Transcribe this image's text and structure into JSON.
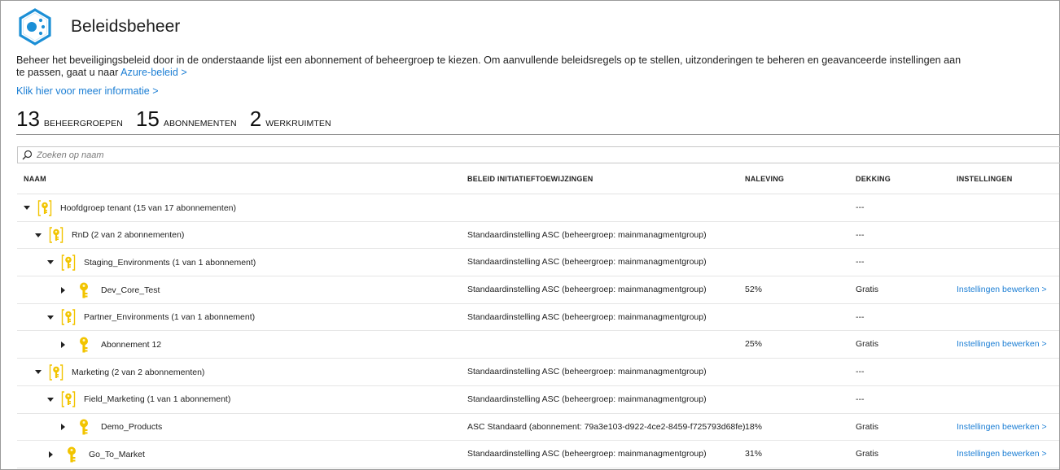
{
  "header": {
    "title": "Beleidsbeheer"
  },
  "description": {
    "text": "Beheer het beveiligingsbeleid door in de onderstaande lijst een abonnement of beheergroep te kiezen. Om aanvullende beleidsregels op te stellen, uitzonderingen te beheren en geavanceerde instellingen aan te passen, gaat u naar ",
    "link": "Azure-beleid >"
  },
  "more_info_link": "Klik hier voor meer informatie >",
  "stats": [
    {
      "value": "13",
      "label": "BEHEERGROEPEN"
    },
    {
      "value": "15",
      "label": "ABONNEMENTEN"
    },
    {
      "value": "2",
      "label": "WERKRUIMTEN"
    }
  ],
  "search": {
    "placeholder": "Zoeken op naam"
  },
  "table": {
    "headers": [
      "NAAM",
      "BELEID INITIATIEFTOEWIJZINGEN",
      "NALEVING",
      "DEKKING",
      "INSTELLINGEN"
    ],
    "rows": [
      {
        "type": "group",
        "expanded": true,
        "level": 0,
        "name": "Hoofdgroep tenant (15 van 17 abonnementen)",
        "policy": "",
        "compliance": "",
        "coverage": "---",
        "settings": ""
      },
      {
        "type": "group",
        "expanded": true,
        "level": 1,
        "name": "RnD (2 van 2 abonnementen)",
        "policy": "Standaardinstelling ASC (beheergroep: mainmanagmentgroup)",
        "compliance": "",
        "coverage": "---",
        "settings": ""
      },
      {
        "type": "group",
        "expanded": true,
        "level": 2,
        "name": "Staging_Environments (1 van 1 abonnement)",
        "policy": "Standaardinstelling ASC (beheergroep: mainmanagmentgroup)",
        "compliance": "",
        "coverage": "---",
        "settings": ""
      },
      {
        "type": "subscription",
        "expanded": false,
        "level": 3,
        "name": "Dev_Core_Test",
        "policy": "Standaardinstelling ASC (beheergroep: mainmanagmentgroup)",
        "compliance": "52%",
        "coverage": "Gratis",
        "settings": "Instellingen bewerken >"
      },
      {
        "type": "group",
        "expanded": true,
        "level": 2,
        "name": "Partner_Environments (1 van 1 abonnement)",
        "policy": "Standaardinstelling ASC (beheergroep: mainmanagmentgroup)",
        "compliance": "",
        "coverage": "---",
        "settings": ""
      },
      {
        "type": "subscription",
        "expanded": false,
        "level": 3,
        "name": "Abonnement 12",
        "policy": "",
        "compliance": "25%",
        "coverage": "Gratis",
        "settings": "Instellingen bewerken >"
      },
      {
        "type": "group",
        "expanded": true,
        "level": 1,
        "name": "Marketing (2 van 2 abonnementen)",
        "policy": "Standaardinstelling ASC (beheergroep: mainmanagmentgroup)",
        "compliance": "",
        "coverage": "---",
        "settings": ""
      },
      {
        "type": "group",
        "expanded": true,
        "level": 2,
        "name": "Field_Marketing (1 van 1 abonnement)",
        "policy": "Standaardinstelling ASC (beheergroep: mainmanagmentgroup)",
        "compliance": "",
        "coverage": "---",
        "settings": ""
      },
      {
        "type": "subscription",
        "expanded": false,
        "level": 3,
        "name": "Demo_Products",
        "policy": "ASC Standaard (abonnement: 79a3e103-d922-4ce2-8459-f725793d68fe)",
        "compliance": "18%",
        "coverage": "Gratis",
        "settings": "Instellingen bewerken >"
      },
      {
        "type": "subscription",
        "expanded": false,
        "level": 2,
        "name": "Go_To_Market",
        "policy": "Standaardinstelling ASC (beheergroep: mainmanagmentgroup)",
        "compliance": "31%",
        "coverage": "Gratis",
        "settings": "Instellingen bewerken >"
      }
    ]
  },
  "colors": {
    "link": "#1b7ed4",
    "key_yellow": "#f2c400",
    "logo_blue": "#1b8fd6"
  }
}
